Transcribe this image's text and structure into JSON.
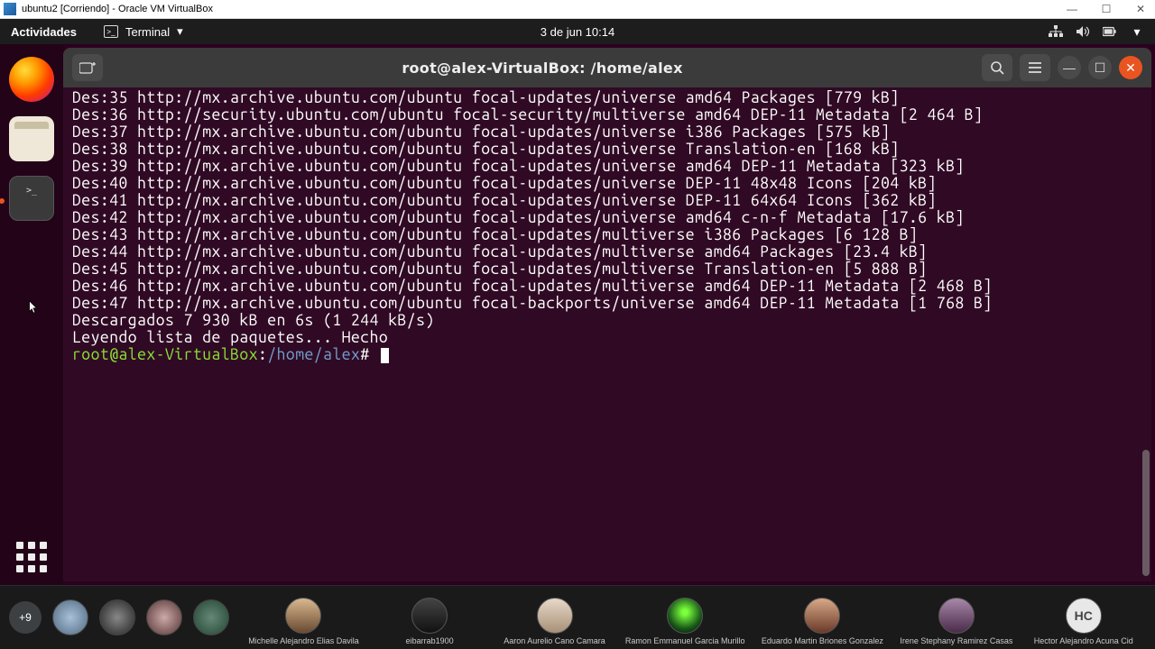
{
  "host": {
    "title": "ubuntu2 [Corriendo] - Oracle VM VirtualBox"
  },
  "gnome": {
    "activities": "Actividades",
    "terminal_label": "Terminal",
    "datetime": "3 de jun  10:14"
  },
  "termwin": {
    "title": "root@alex-VirtualBox: /home/alex",
    "prompt_user": "root@alex-VirtualBox",
    "prompt_path": "/home/alex",
    "prompt_suffix": "#",
    "lines": [
      "Des:35 http://mx.archive.ubuntu.com/ubuntu focal-updates/universe amd64 Packages [779 kB]",
      "Des:36 http://security.ubuntu.com/ubuntu focal-security/multiverse amd64 DEP-11 Metadata [2 464 B]",
      "Des:37 http://mx.archive.ubuntu.com/ubuntu focal-updates/universe i386 Packages [575 kB]",
      "Des:38 http://mx.archive.ubuntu.com/ubuntu focal-updates/universe Translation-en [168 kB]",
      "Des:39 http://mx.archive.ubuntu.com/ubuntu focal-updates/universe amd64 DEP-11 Metadata [323 kB]",
      "Des:40 http://mx.archive.ubuntu.com/ubuntu focal-updates/universe DEP-11 48x48 Icons [204 kB]",
      "Des:41 http://mx.archive.ubuntu.com/ubuntu focal-updates/universe DEP-11 64x64 Icons [362 kB]",
      "Des:42 http://mx.archive.ubuntu.com/ubuntu focal-updates/universe amd64 c-n-f Metadata [17.6 kB]",
      "Des:43 http://mx.archive.ubuntu.com/ubuntu focal-updates/multiverse i386 Packages [6 128 B]",
      "Des:44 http://mx.archive.ubuntu.com/ubuntu focal-updates/multiverse amd64 Packages [23.4 kB]",
      "Des:45 http://mx.archive.ubuntu.com/ubuntu focal-updates/multiverse Translation-en [5 888 B]",
      "Des:46 http://mx.archive.ubuntu.com/ubuntu focal-updates/multiverse amd64 DEP-11 Metadata [2 468 B]",
      "Des:47 http://mx.archive.ubuntu.com/ubuntu focal-backports/universe amd64 DEP-11 Metadata [1 768 B]",
      "Descargados 7 930 kB en 6s (1 244 kB/s)",
      "Leyendo lista de paquetes... Hecho"
    ]
  },
  "meet": {
    "overflow": "+9",
    "participants": [
      {
        "name": "Michelle Alejandro Elias Davila"
      },
      {
        "name": "eibarrab1900"
      },
      {
        "name": "Aaron Aurelio Cano Camara"
      },
      {
        "name": "Ramon Emmanuel Garcia Murillo"
      },
      {
        "name": "Eduardo Martin Briones Gonzalez"
      },
      {
        "name": "Irene Stephany Ramirez Casas"
      },
      {
        "name": "Hector Alejandro Acuna Cid"
      }
    ],
    "hc_initials": "HC"
  }
}
